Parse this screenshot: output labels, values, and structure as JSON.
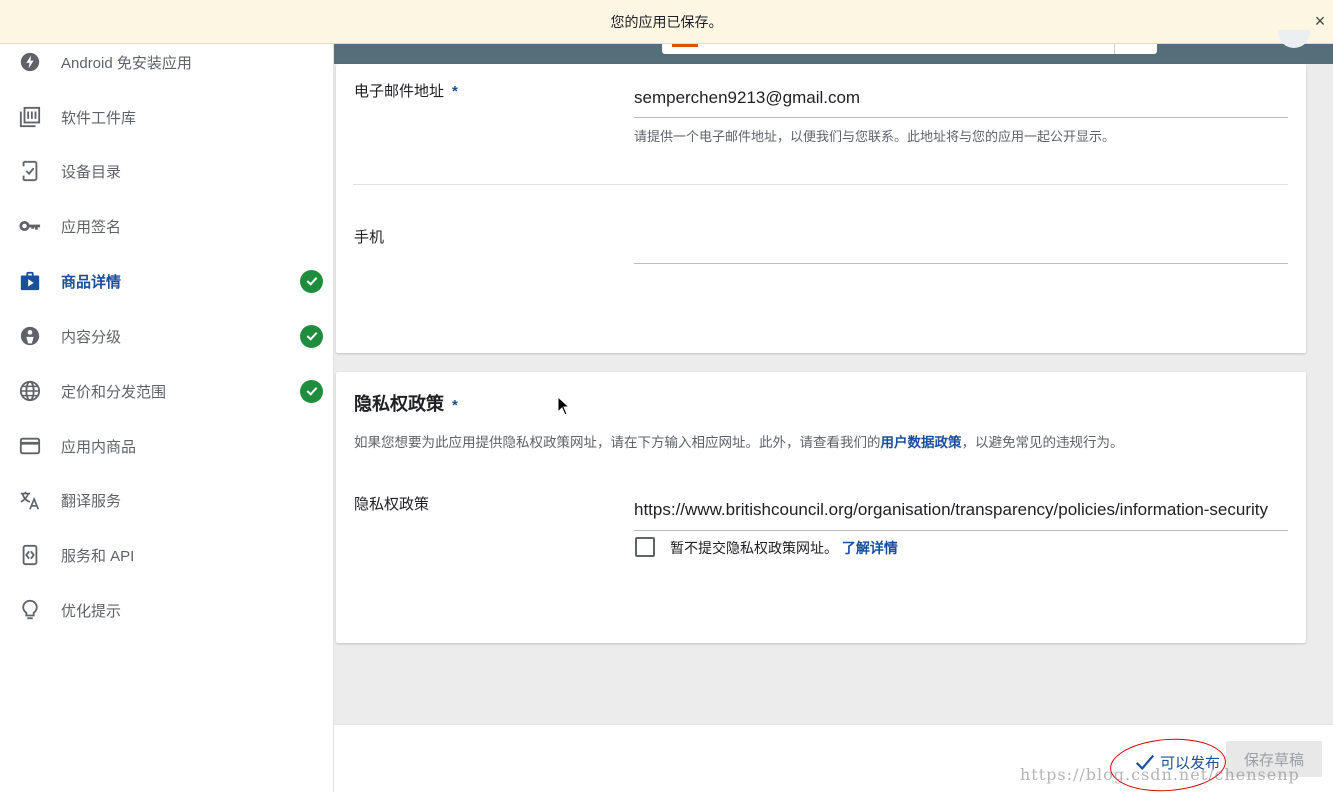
{
  "toast": {
    "message": "您的应用已保存。",
    "close_glyph": "×"
  },
  "header": {
    "status_text_partial": "可以发布"
  },
  "sidebar": {
    "items": [
      {
        "label": "Android 免安装应用",
        "icon": "android-instant-icon",
        "active": false,
        "checked": false
      },
      {
        "label": "软件工件库",
        "icon": "library-icon",
        "active": false,
        "checked": false
      },
      {
        "label": "设备目录",
        "icon": "device-catalog-icon",
        "active": false,
        "checked": false
      },
      {
        "label": "应用签名",
        "icon": "key-icon",
        "active": false,
        "checked": false
      },
      {
        "label": "商品详情",
        "icon": "store-listing-icon",
        "active": true,
        "checked": true
      },
      {
        "label": "内容分级",
        "icon": "content-rating-icon",
        "active": false,
        "checked": true
      },
      {
        "label": "定价和分发范围",
        "icon": "globe-icon",
        "active": false,
        "checked": true
      },
      {
        "label": "应用内商品",
        "icon": "credit-card-icon",
        "active": false,
        "checked": false
      },
      {
        "label": "翻译服务",
        "icon": "translate-icon",
        "active": false,
        "checked": false
      },
      {
        "label": "服务和 API",
        "icon": "api-icon",
        "active": false,
        "checked": false
      },
      {
        "label": "优化提示",
        "icon": "lightbulb-icon",
        "active": false,
        "checked": false
      }
    ]
  },
  "contact": {
    "email_label": "电子邮件地址",
    "required_mark": "*",
    "email_value": "semperchen9213@gmail.com",
    "email_helper": "请提供一个电子邮件地址，以便我们与您联系。此地址将与您的应用一起公开显示。",
    "phone_label": "手机",
    "phone_value": ""
  },
  "privacy": {
    "title": "隐私权政策",
    "required_mark": "*",
    "desc_before": "如果您想要为此应用提供隐私权政策网址，请在下方输入相应网址。此外，请查看我们的",
    "desc_link": "用户数据政策",
    "desc_after": "，以避免常见的违规行为。",
    "field_label": "隐私权政策",
    "url_value": "https://www.britishcouncil.org/organisation/transparency/policies/information-security",
    "checkbox_label": "暂不提交隐私权政策网址。",
    "learn_more": "了解详情"
  },
  "footer": {
    "publish_status": "可以发布",
    "save_draft": "保存草稿",
    "watermark": "https://blog.csdn.net/chensenp"
  },
  "colors": {
    "accent": "#1a4f9c",
    "success": "#1e8e3e",
    "header": "#546e7a",
    "toast_bg": "#fdf6e3",
    "annotation": "#d40000"
  }
}
